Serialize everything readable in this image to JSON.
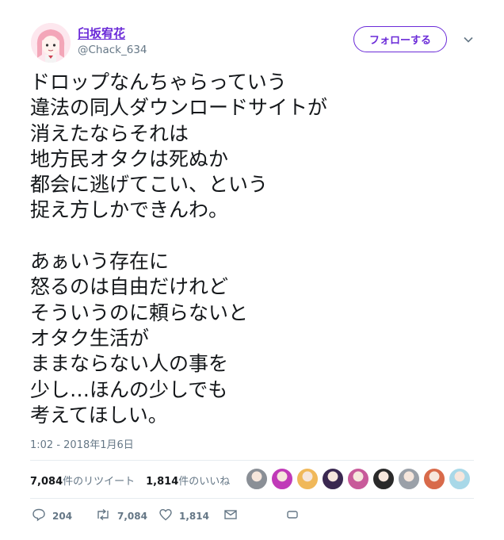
{
  "user": {
    "display_name": "臼坂宥花",
    "handle": "@Chack_634"
  },
  "follow_button": {
    "label": "フォローする"
  },
  "tweet": {
    "lines": [
      "ドロップなんちゃらっていう",
      "違法の同人ダウンロードサイトが",
      "消えたならそれは",
      "地方民オタクは死ぬか",
      "都会に逃げてこい、という",
      "捉え方しかできんわ。",
      "",
      "あぁいう存在に",
      "怒るのは自由だけれど",
      "そういうのに頼らないと",
      "オタク生活が",
      "ままならない人の事を",
      "少し…ほんの少しでも",
      "考えてほしい。"
    ],
    "timestamp": "1:02 - 2018年1月6日"
  },
  "stats": {
    "retweet_count": "7,084",
    "retweet_label": "件のリツイート",
    "like_count": "1,814",
    "like_label": "件のいいね"
  },
  "likers": [
    {
      "color": "#8a8f96",
      "icon": "liker-avatar"
    },
    {
      "color": "#c03ab8",
      "icon": "liker-avatar"
    },
    {
      "color": "#f0b85a",
      "icon": "liker-avatar"
    },
    {
      "color": "#3a2850",
      "icon": "liker-avatar"
    },
    {
      "color": "#c85a9a",
      "icon": "liker-avatar"
    },
    {
      "color": "#2a2a2a",
      "icon": "liker-avatar"
    },
    {
      "color": "#9aa0a8",
      "icon": "liker-avatar"
    },
    {
      "color": "#d86a4a",
      "icon": "liker-avatar"
    },
    {
      "color": "#a8d8e8",
      "icon": "liker-avatar"
    }
  ],
  "actions": {
    "reply_count": "204",
    "retweet_count": "7,084",
    "like_count": "1,814"
  },
  "colors": {
    "accent": "#6b2bd8",
    "muted": "#657786",
    "divider": "#e6ecf0"
  }
}
